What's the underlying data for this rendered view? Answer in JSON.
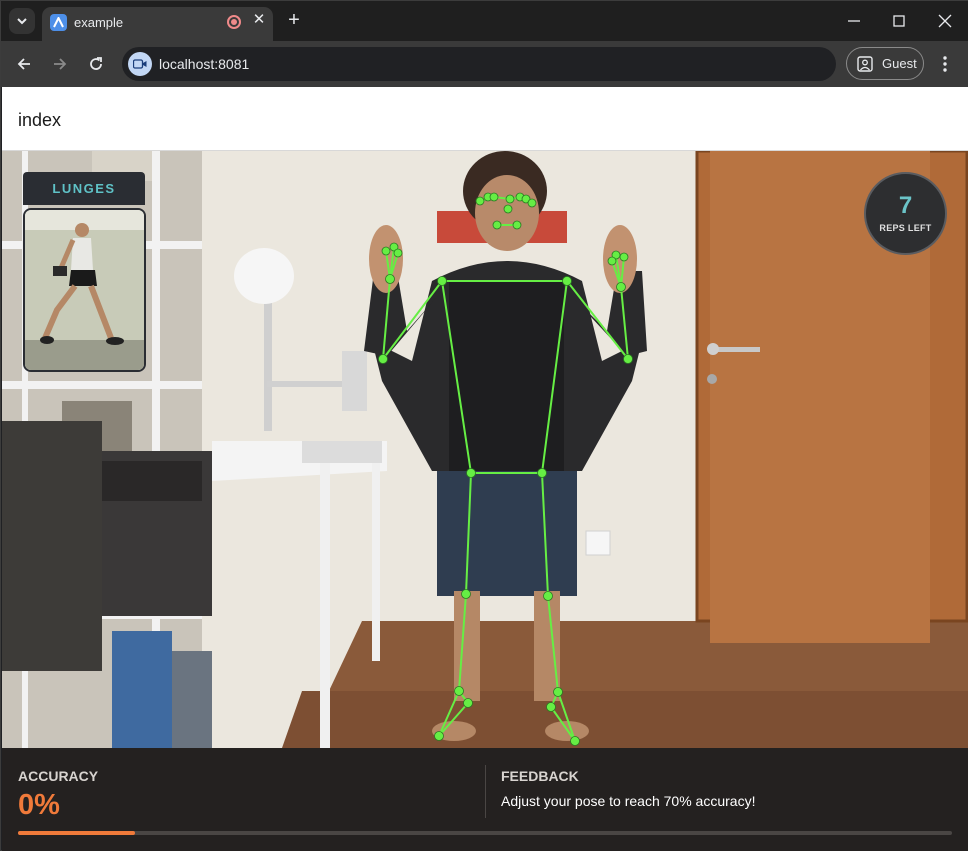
{
  "browser": {
    "tab_title": "example",
    "tab_close": "✕",
    "new_tab": "+",
    "url": "localhost:8081",
    "profile_label": "Guest"
  },
  "page": {
    "title": "index"
  },
  "exercise": {
    "name": "LUNGES"
  },
  "reps": {
    "count": "7",
    "label": "REPS LEFT"
  },
  "stats": {
    "accuracy_label": "ACCURACY",
    "accuracy_value": "0%",
    "feedback_label": "FEEDBACK",
    "feedback_text": "Adjust your pose to reach 70% accuracy!",
    "progress_fraction": 0.125
  },
  "colors": {
    "accent_teal": "#6bc4c8",
    "accent_orange": "#f07a3a",
    "skeleton_green": "#66ee44"
  }
}
